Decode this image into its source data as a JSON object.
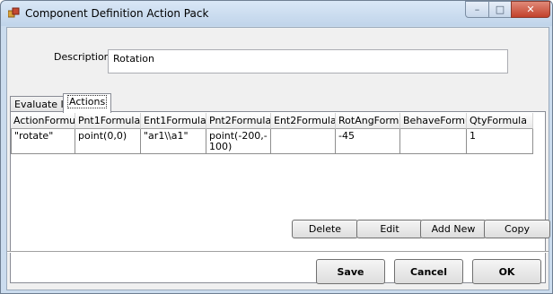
{
  "window": {
    "title": "Component Definition Action Pack",
    "minimize_glyph": "–",
    "maximize_glyph": "□",
    "close_glyph": "✕"
  },
  "description": {
    "label": "Description",
    "value": "Rotation"
  },
  "tabs": [
    {
      "label": "Evaluate If"
    },
    {
      "label": "Actions"
    }
  ],
  "grid": {
    "columns": [
      "ActionFormul",
      "Pnt1Formula",
      "Ent1Formula",
      "Pnt2Formula",
      "Ent2Formula",
      "RotAngFormu",
      "BehaveFormu",
      "QtyFormula"
    ],
    "rows": [
      [
        "\"rotate\"",
        "point(0,0)",
        "\"ar1\\\\a1\"",
        "point(-200,-100)",
        "",
        "-45",
        "",
        "1"
      ]
    ]
  },
  "grid_buttons": {
    "delete": "Delete",
    "edit": "Edit",
    "add_new": "Add New",
    "copy": "Copy"
  },
  "dialog_buttons": {
    "save": "Save",
    "cancel": "Cancel",
    "ok": "OK"
  }
}
